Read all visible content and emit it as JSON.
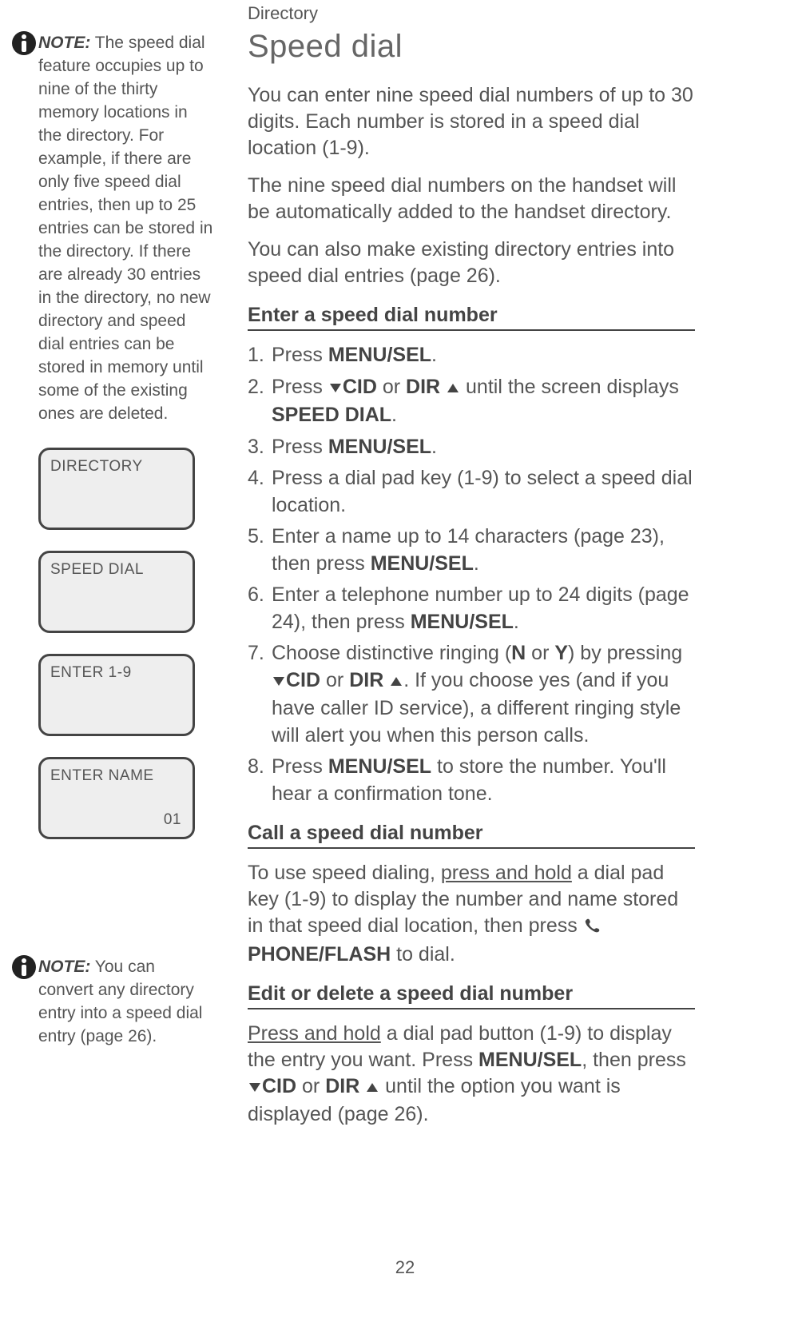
{
  "header": "Directory",
  "page_number": "22",
  "sidebar": {
    "note1": {
      "label": "NOTE:",
      "text": "The speed dial feature occupies up to nine of the thirty memory locations in the directory. For example, if there are only five speed dial entries, then up to 25 entries can be stored in the directory. If there are already 30 entries in the directory, no new directory and speed dial entries can be stored in memory until some of the existing ones are deleted."
    },
    "screens": {
      "s1": {
        "line1": "DIRECTORY",
        "line2": ""
      },
      "s2": {
        "line1": "SPEED DIAL",
        "line2": ""
      },
      "s3": {
        "line1": "ENTER 1-9",
        "line2": ""
      },
      "s4": {
        "line1": "ENTER NAME",
        "line2": "01"
      }
    },
    "note2": {
      "label": "NOTE:",
      "text": "You can convert any directory entry into a speed dial entry (page 26)."
    }
  },
  "main": {
    "title": "Speed dial",
    "intro": [
      "You can enter nine speed dial numbers of up to 30 digits. Each number is stored in a speed dial location (1-9).",
      "The nine speed dial numbers on the handset will be automatically added to the handset directory.",
      "You can also make existing directory entries into speed dial entries (page 26)."
    ],
    "sec1": {
      "heading": "Enter a speed dial number",
      "step1_a": "Press ",
      "step1_b": "MENU/",
      "step1_c": "SEL",
      "step1_d": ".",
      "step2_a": "Press ",
      "step2_b": "CID",
      "step2_c": "  or ",
      "step2_d": "DIR",
      "step2_e": "  until the screen  displays ",
      "step2_f": "SPEED DIAL",
      "step2_g": ".",
      "step3_a": "Press ",
      "step3_b": "MENU",
      "step3_c": "/SEL",
      "step3_d": ".",
      "step4": "Press a dial pad key (1-9) to select a speed dial location.",
      "step5_a": "Enter a name up to 14 characters (page 23), then press ",
      "step5_b": "MENU",
      "step5_c": "/SEL",
      "step5_d": ".",
      "step6_a": "Enter a telephone number up to 24 digits (page 24), then press ",
      "step6_b": "MENU",
      "step6_c": "/SEL",
      "step6_d": ".",
      "step7_a": "Choose distinctive ringing (",
      "step7_b": "N",
      "step7_c": " or ",
      "step7_d": "Y",
      "step7_e": ") by pressing ",
      "step7_f": "CID",
      "step7_g": "  or ",
      "step7_h": "DIR",
      "step7_i": ". If you choose yes (and if you have caller ID service), a different ringing style will alert you when this person calls.",
      "step8_a": "Press ",
      "step8_b": "MENU",
      "step8_c": "/SEL",
      "step8_d": " to store the number. You'll hear a confirmation tone."
    },
    "sec2": {
      "heading": "Call a speed dial number",
      "p_a": "To use speed dialing, ",
      "p_b": "press and hold",
      "p_c": " a dial pad key (1-9) to display the number and name stored in that speed dial location, then press ",
      "p_d": "PHONE/",
      "p_e": "FLASH",
      "p_f": " to dial."
    },
    "sec3": {
      "heading": "Edit or delete a speed dial number",
      "p_a": "Press and hold",
      "p_b": " a dial pad button (1-9) to display the entry you want. Press ",
      "p_c": "MENU/SEL",
      "p_d": ", then press ",
      "p_e": "CID",
      "p_f": "  or ",
      "p_g": "DIR",
      "p_h": " until the option you want is displayed (page 26)."
    }
  }
}
